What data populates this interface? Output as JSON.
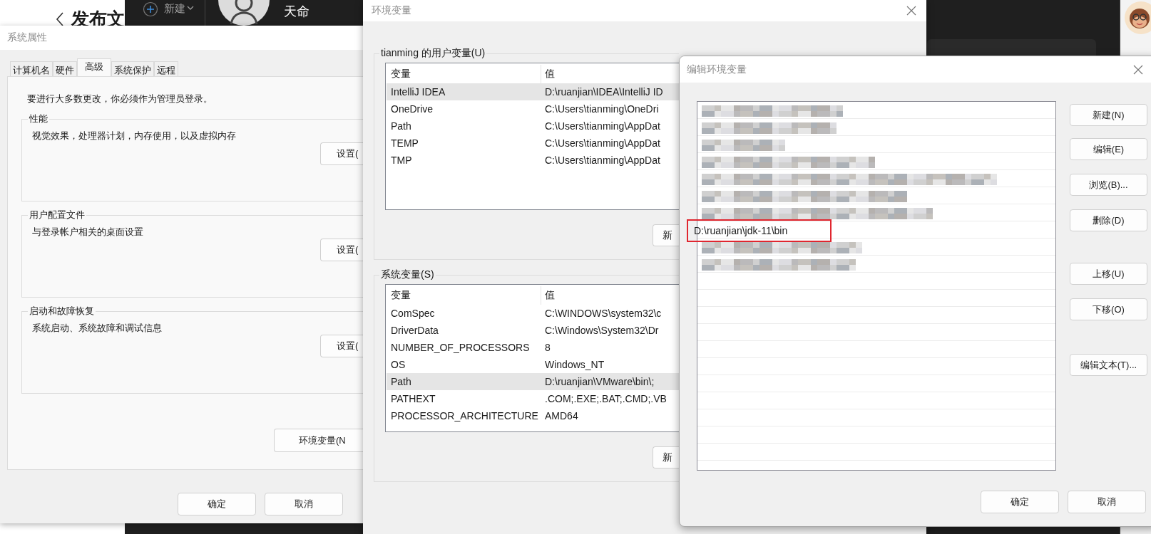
{
  "background_page": {
    "title": "发布文",
    "new_label": "新建",
    "user_name": "天命"
  },
  "system_properties": {
    "title": "系统属性",
    "tabs": [
      {
        "label": "计算机名",
        "selected": false
      },
      {
        "label": "硬件",
        "selected": false
      },
      {
        "label": "高级",
        "selected": true
      },
      {
        "label": "系统保护",
        "selected": false
      },
      {
        "label": "远程",
        "selected": false
      }
    ],
    "notice": "要进行大多数更改，你必须作为管理员登录。",
    "groups": [
      {
        "title": "性能",
        "description": "视觉效果，处理器计划，内存使用，以及虚拟内存",
        "button": "设置("
      },
      {
        "title": "用户配置文件",
        "description": "与登录帐户相关的桌面设置",
        "button": "设置("
      },
      {
        "title": "启动和故障恢复",
        "description": "系统启动、系统故障和调试信息",
        "button": "设置("
      }
    ],
    "env_button": "环境变量(N",
    "buttons": [
      "确定",
      "取消"
    ]
  },
  "environment_variables": {
    "title": "环境变量",
    "user_vars": {
      "title": "tianming 的用户变量(U)",
      "columns": [
        "变量",
        "值"
      ],
      "rows": [
        {
          "name": "IntelliJ IDEA",
          "value": "D:\\ruanjian\\IDEA\\IntelliJ ID",
          "selected": true
        },
        {
          "name": "OneDrive",
          "value": "C:\\Users\\tianming\\OneDri",
          "selected": false
        },
        {
          "name": "Path",
          "value": "C:\\Users\\tianming\\AppDat",
          "selected": false
        },
        {
          "name": "TEMP",
          "value": "C:\\Users\\tianming\\AppDat",
          "selected": false
        },
        {
          "name": "TMP",
          "value": "C:\\Users\\tianming\\AppDat",
          "selected": false
        }
      ],
      "button": "新"
    },
    "system_vars": {
      "title": "系统变量(S)",
      "columns": [
        "变量",
        "值"
      ],
      "rows": [
        {
          "name": "ComSpec",
          "value": "C:\\WINDOWS\\system32\\c",
          "selected": false
        },
        {
          "name": "DriverData",
          "value": "C:\\Windows\\System32\\Dr",
          "selected": false
        },
        {
          "name": "NUMBER_OF_PROCESSORS",
          "value": "8",
          "selected": false
        },
        {
          "name": "OS",
          "value": "Windows_NT",
          "selected": false
        },
        {
          "name": "Path",
          "value": "D:\\ruanjian\\VMware\\bin\\;",
          "selected": true
        },
        {
          "name": "PATHEXT",
          "value": ".COM;.EXE;.BAT;.CMD;.VB",
          "selected": false
        },
        {
          "name": "PROCESSOR_ARCHITECTURE",
          "value": "AMD64",
          "selected": false
        }
      ],
      "button": "新"
    }
  },
  "edit_env_var": {
    "title": "编辑环境变量",
    "entries": [
      {
        "kind": "blurred"
      },
      {
        "kind": "blurred"
      },
      {
        "kind": "blurred"
      },
      {
        "kind": "blurred"
      },
      {
        "kind": "blurred"
      },
      {
        "kind": "blurred"
      },
      {
        "kind": "blurred"
      },
      {
        "kind": "text",
        "text": "D:\\ruanjian\\jdk-11\\bin",
        "highlighted": true
      },
      {
        "kind": "blurred"
      },
      {
        "kind": "blurred"
      }
    ],
    "side_buttons": [
      "新建(N)",
      "编辑(E)",
      "浏览(B)...",
      "删除(D)",
      "上移(U)",
      "下移(O)",
      "编辑文本(T)..."
    ],
    "buttons": [
      "确定",
      "取消"
    ]
  }
}
